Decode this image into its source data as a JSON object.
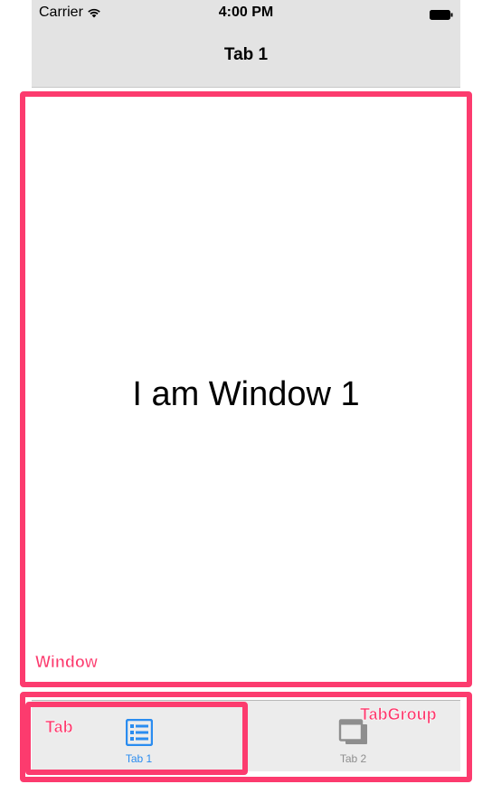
{
  "status_bar": {
    "carrier": "Carrier",
    "time": "4:00 PM",
    "wifi_icon": "wifi-icon",
    "battery_icon": "battery-icon"
  },
  "nav_bar": {
    "title": "Tab 1"
  },
  "window": {
    "text": "I am Window 1"
  },
  "tab_bar": {
    "tabs": [
      {
        "label": "Tab 1",
        "icon": "list-icon",
        "selected": true
      },
      {
        "label": "Tab 2",
        "icon": "windows-icon",
        "selected": false
      }
    ]
  },
  "annotations": {
    "window": "Window",
    "tab": "Tab",
    "tabgroup": "TabGroup",
    "color": "#fc3b6e"
  },
  "colors": {
    "accent": "#2a8cf0",
    "inactive": "#8e8e8e",
    "bar_background": "#e3e3e3"
  }
}
